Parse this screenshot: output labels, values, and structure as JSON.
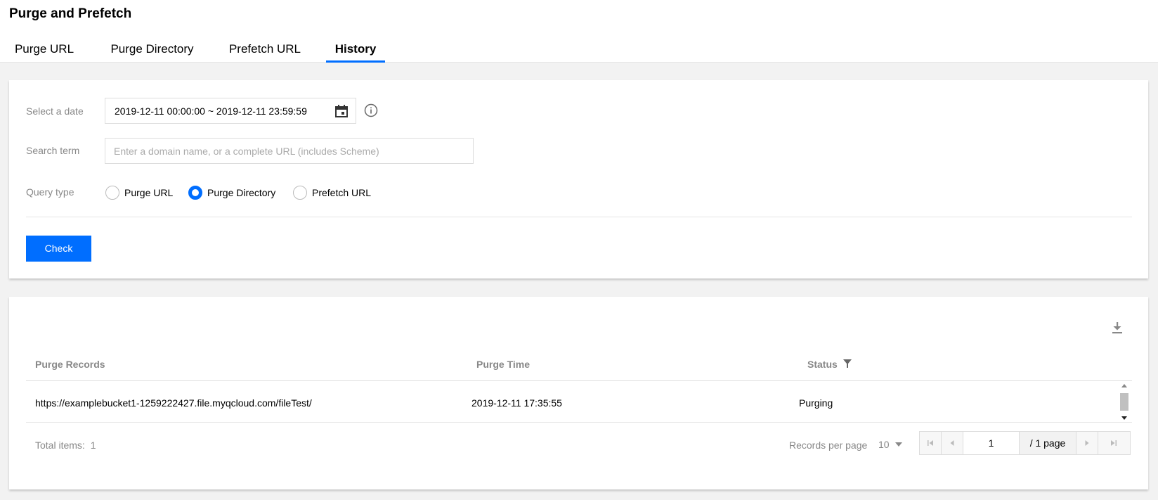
{
  "header": {
    "title": "Purge and Prefetch",
    "tabs": [
      {
        "label": "Purge URL",
        "active": false
      },
      {
        "label": "Purge Directory",
        "active": false
      },
      {
        "label": "Prefetch URL",
        "active": false
      },
      {
        "label": "History",
        "active": true
      }
    ]
  },
  "filters": {
    "date_label": "Select a date",
    "date_range": "2019-12-11 00:00:00 ~ 2019-12-11 23:59:59",
    "search_label": "Search term",
    "search_value": "",
    "search_placeholder": "Enter a domain name, or a complete URL (includes Scheme)",
    "query_type_label": "Query type",
    "query_types": [
      {
        "label": "Purge URL",
        "checked": false
      },
      {
        "label": "Purge Directory",
        "checked": true
      },
      {
        "label": "Prefetch URL",
        "checked": false
      }
    ],
    "check_label": "Check"
  },
  "table": {
    "columns": [
      "Purge Records",
      "Purge Time",
      "Status"
    ],
    "rows": [
      {
        "record": "https://examplebucket1-1259222427.file.myqcloud.com/fileTest/",
        "time": "2019-12-11 17:35:55",
        "status": "Purging"
      }
    ]
  },
  "pagination": {
    "total_label": "Total items:",
    "total_count": "1",
    "records_per_page_label": "Records per page",
    "records_per_page": "10",
    "current_page": "1",
    "page_total": "/ 1 page"
  },
  "colors": {
    "accent": "#006eff",
    "muted_text": "#888888",
    "background": "#f2f2f2"
  }
}
